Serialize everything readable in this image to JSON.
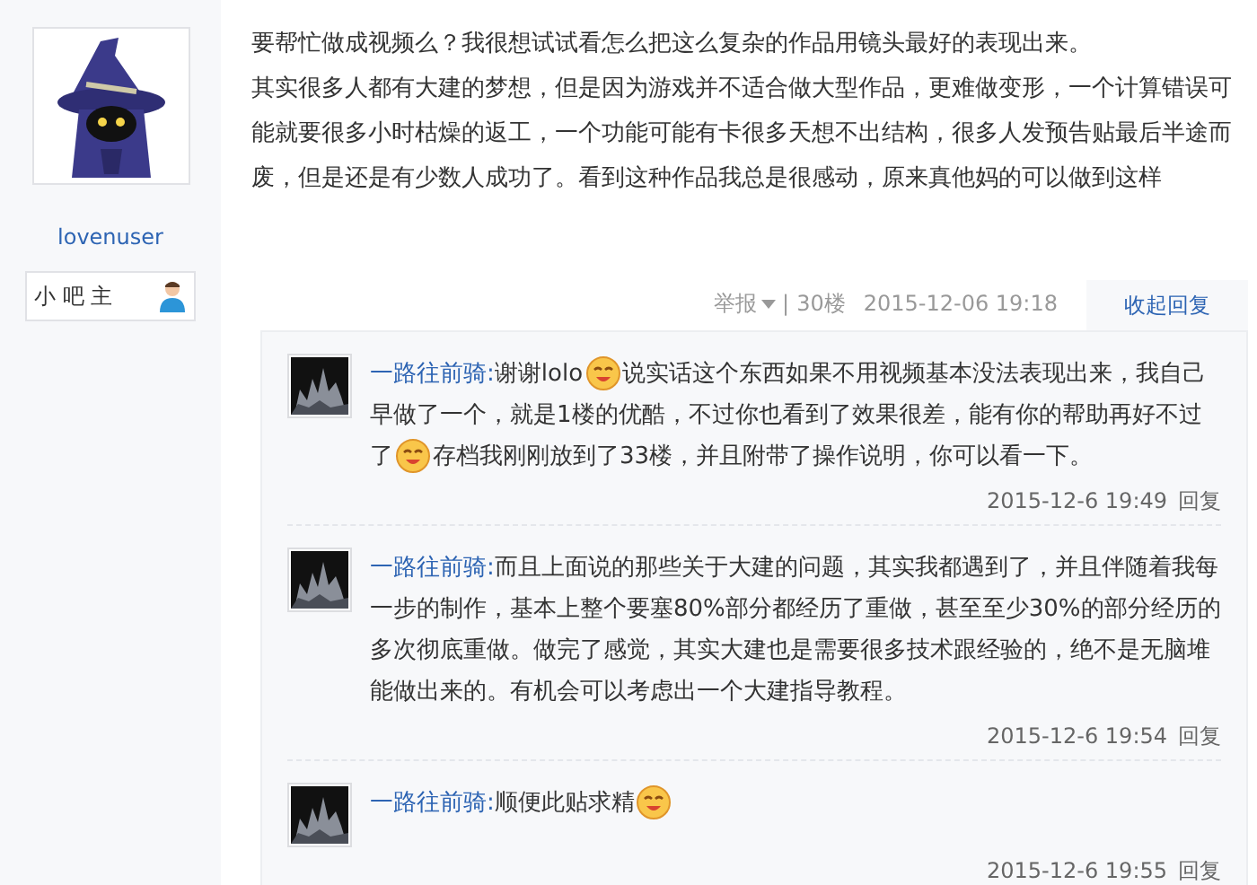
{
  "author": {
    "name": "lovenuser",
    "badge": "小 吧 主"
  },
  "post": {
    "paragraphs": [
      "要帮忙做成视频么？我很想试试看怎么把这么复杂的作品用镜头最好的表现出来。",
      "其实很多人都有大建的梦想，但是因为游戏并不适合做大型作品，更难做变形，一个计算错误可能就要很多小时枯燥的返工，一个功能可能有卡很多天想不出结构，很多人发预告贴最后半途而废，但是还是有少数人成功了。看到这种作品我总是很感动，原来真他妈的可以做到这样"
    ],
    "report": "举报",
    "separator": "|",
    "floor": "30楼",
    "time": "2015-12-06 19:18",
    "toggle": "收起回复"
  },
  "replies": [
    {
      "user": "一路往前骑:",
      "time": "2015-12-6 19:49",
      "reply": "回复",
      "segments": [
        {
          "kind": "text",
          "text": "谢谢lolo"
        },
        {
          "kind": "emoticon"
        },
        {
          "kind": "text",
          "text": "说实话这个东西如果不用视频基本没法表现出来，我自己早做了一个，就是1楼的优酷，不过你也看到了效果很差，能有你的帮助再好不过了"
        },
        {
          "kind": "emoticon"
        },
        {
          "kind": "text",
          "text": "存档我刚刚放到了33楼，并且附带了操作说明，你可以看一下。"
        }
      ]
    },
    {
      "user": "一路往前骑:",
      "time": "2015-12-6 19:54",
      "reply": "回复",
      "segments": [
        {
          "kind": "text",
          "text": "而且上面说的那些关于大建的问题，其实我都遇到了，并且伴随着我每一步的制作，基本上整个要塞80%部分都经历了重做，甚至至少30%的部分经历的多次彻底重做。做完了感觉，其实大建也是需要很多技术跟经验的，绝不是无脑堆能做出来的。有机会可以考虑出一个大建指导教程。"
        }
      ]
    },
    {
      "user": "一路往前骑:",
      "time": "2015-12-6 19:55",
      "reply": "回复",
      "segments": [
        {
          "kind": "text",
          "text": "顺便此贴求精"
        },
        {
          "kind": "emoticon"
        }
      ]
    }
  ]
}
